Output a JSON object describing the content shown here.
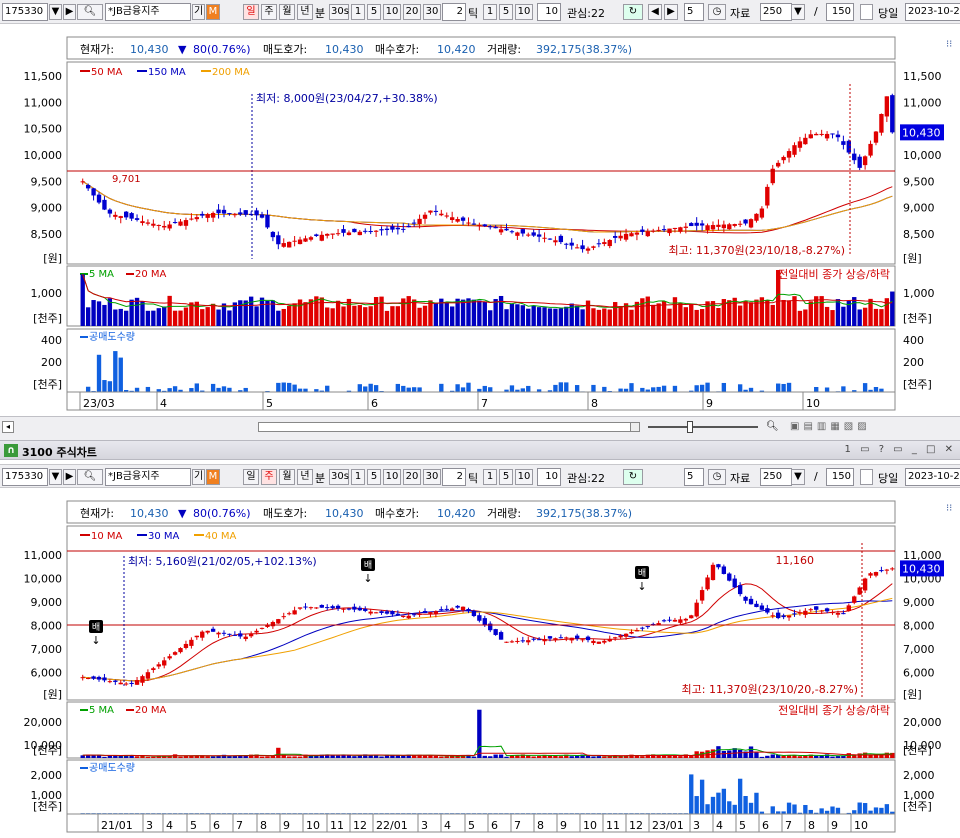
{
  "toolbar": {
    "code": "175330",
    "name": "*JB금융지주",
    "gi": "기",
    "m": "M",
    "periods": [
      "일",
      "주",
      "월",
      "년",
      "분"
    ],
    "mins": [
      "30s",
      "1",
      "5",
      "10",
      "20",
      "30"
    ],
    "tick_val": "2",
    "tick": "틱",
    "tick_btns": [
      "1",
      "5",
      "10"
    ],
    "ten": "10",
    "gwansim": "관심:22",
    "num5": "5",
    "jaryo": "자료",
    "count": "250",
    "slash": "/",
    "total": "150",
    "dangil": "당일",
    "date": "2023-10-2"
  },
  "chart1": {
    "header": {
      "price_lbl": "현재가:",
      "price": "10,430",
      "chg": "80(0.76%)",
      "ask_lbl": "매도호가:",
      "ask": "10,430",
      "bid_lbl": "매수호가:",
      "bid": "10,420",
      "vol_lbl": "거래량:",
      "vol": "392,175(38.37%)"
    },
    "legend": [
      "50 MA",
      "150 MA",
      "200 MA"
    ],
    "ma_colors": [
      "#d00000",
      "#0000c0",
      "#f0a000"
    ],
    "yticks": [
      "11,500",
      "11,000",
      "10,500",
      "10,000",
      "9,500",
      "9,000",
      "8,500"
    ],
    "unit": "[원]",
    "current": "10,430",
    "low_annot": "최저: 8,000원(23/04/27,+30.38%)",
    "high_annot": "최고: 11,370원(23/10/18,-8.27%)",
    "ref_val": "9,701",
    "vol_legend": [
      "5 MA",
      "20 MA"
    ],
    "vol_right": "전일대비 종가 상승/하락",
    "vol_ticks": [
      "1,000"
    ],
    "vol_unit": "[천주]",
    "short_legend": "공매도수량",
    "short_ticks": [
      "400",
      "200"
    ],
    "short_unit": "[천주]",
    "xlabels": [
      "23/03",
      "4",
      "5",
      "6",
      "7",
      "8",
      "9",
      "10"
    ]
  },
  "window2": {
    "title": "3100 주식차트",
    "icon": "∩"
  },
  "chart2": {
    "header": {
      "price_lbl": "현재가:",
      "price": "10,430",
      "chg": "80(0.76%)",
      "ask_lbl": "매도호가:",
      "ask": "10,430",
      "bid_lbl": "매수호가:",
      "bid": "10,420",
      "vol_lbl": "거래량:",
      "vol": "392,175(38.37%)"
    },
    "legend": [
      "10 MA",
      "30 MA",
      "40 MA"
    ],
    "ma_colors": [
      "#d00000",
      "#0000c0",
      "#f0a000"
    ],
    "yticks": [
      "11,000",
      "10,000",
      "9,000",
      "8,000",
      "7,000",
      "6,000"
    ],
    "unit": "[원]",
    "current": "10,430",
    "low_annot": "최저: 5,160원(21/02/05,+102.13%)",
    "high_annot": "최고: 11,370원(23/10/20,-8.27%)",
    "ref_high": "11,160",
    "markers": [
      "배",
      "배",
      "배"
    ],
    "vol_legend": [
      "5 MA",
      "20 MA"
    ],
    "vol_right": "전일대비 종가 상승/하락",
    "vol_ticks": [
      "20,000",
      "10,000"
    ],
    "vol_unit": "[천주]",
    "short_legend": "공매도수량",
    "short_ticks": [
      "2,000",
      "1,000"
    ],
    "short_unit": "[천주]",
    "xlabels": [
      "21/01",
      "3",
      "4",
      "5",
      "6",
      "7",
      "8",
      "9",
      "10",
      "11",
      "12",
      "22/01",
      "3",
      "4",
      "5",
      "6",
      "7",
      "8",
      "9",
      "10",
      "11",
      "12",
      "23/01",
      "3",
      "4",
      "5",
      "6",
      "7",
      "8",
      "9",
      "10"
    ]
  }
}
